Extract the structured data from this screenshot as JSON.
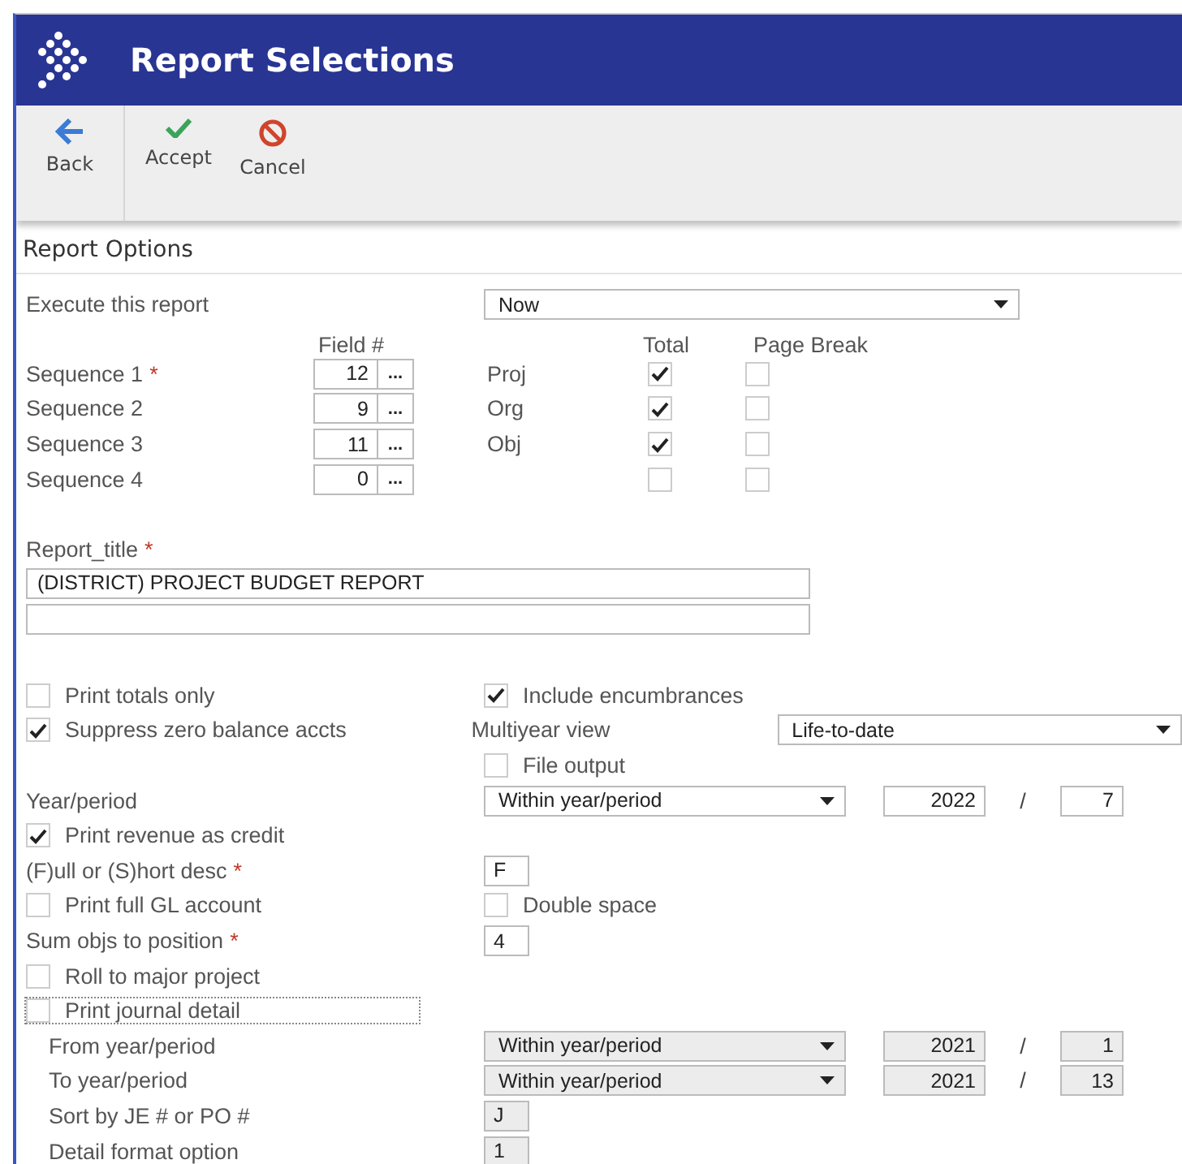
{
  "header": {
    "title": "Report Selections"
  },
  "toolbar": [
    {
      "kind": "back",
      "label": "Back"
    },
    {
      "kind": "accept",
      "label": "Accept"
    },
    {
      "kind": "cancel",
      "label": "Cancel"
    }
  ],
  "section_title": "Report Options",
  "execute": {
    "label": "Execute this report",
    "value": "Now"
  },
  "sequence": {
    "field_heading": "Field #",
    "total_heading": "Total",
    "page_break_heading": "Page Break",
    "more": "...",
    "rows": [
      {
        "label": "Sequence 1",
        "required_mark": "*",
        "field": "12",
        "name": "Proj",
        "total": true,
        "page_break": false
      },
      {
        "label": "Sequence 2",
        "field": "9",
        "name": "Org",
        "total": true,
        "page_break": false
      },
      {
        "label": "Sequence 3",
        "field": "11",
        "name": "Obj",
        "total": true,
        "page_break": false
      },
      {
        "label": "Sequence 4",
        "field": "0",
        "total": false,
        "page_break": false
      }
    ]
  },
  "report_title": {
    "label": "Report_title",
    "required_mark": "*",
    "lines": [
      "(DISTRICT) PROJECT BUDGET REPORT"
    ]
  },
  "options": [
    {
      "left": {
        "kind": "checkbox",
        "label": "Print totals only",
        "checked": false
      },
      "right": [
        {
          "kind": "checkbox",
          "label": "Include encumbrances",
          "checked": true
        }
      ]
    },
    {
      "left": {
        "kind": "checkbox",
        "label": "Suppress zero balance accts",
        "checked": true
      },
      "right": [
        {
          "kind": "caption",
          "label": "Multiyear view"
        },
        {
          "kind": "wide-select",
          "value": "Life-to-date",
          "disabled": false
        }
      ]
    },
    {
      "right": [
        {
          "kind": "checkbox",
          "label": "File output",
          "checked": false
        }
      ]
    },
    {
      "left": {
        "kind": "label",
        "label": "Year/period"
      },
      "right": [
        {
          "kind": "select",
          "value": "Within year/period",
          "disabled": false
        },
        {
          "kind": "year",
          "value": "2022",
          "disabled": false
        },
        {
          "kind": "slash",
          "text": "/"
        },
        {
          "kind": "period",
          "value": "7",
          "disabled": false
        }
      ]
    },
    {
      "left": {
        "kind": "checkbox",
        "label": "Print revenue as credit",
        "checked": true
      }
    },
    {
      "left": {
        "kind": "label",
        "label": "(F)ull or (S)hort desc",
        "required_mark": "*"
      },
      "right": [
        {
          "kind": "char",
          "value": "F",
          "disabled": false
        }
      ]
    },
    {
      "left": {
        "kind": "checkbox",
        "label": "Print full GL account",
        "checked": false
      },
      "right": [
        {
          "kind": "checkbox",
          "label": "Double space",
          "checked": false
        }
      ]
    },
    {
      "left": {
        "kind": "label",
        "label": "Sum objs to position",
        "required_mark": "*"
      },
      "right": [
        {
          "kind": "char",
          "value": "4",
          "disabled": false
        }
      ]
    },
    {
      "left": {
        "kind": "checkbox",
        "label": "Roll to major project",
        "checked": false
      }
    },
    {
      "left": {
        "kind": "checkbox",
        "label": "Print journal detail",
        "checked": false,
        "focused": true
      }
    },
    {
      "left": {
        "kind": "sublabel",
        "label": "From year/period"
      },
      "right": [
        {
          "kind": "select",
          "value": "Within year/period",
          "disabled": true
        },
        {
          "kind": "year",
          "value": "2021",
          "disabled": true
        },
        {
          "kind": "slash",
          "text": "/"
        },
        {
          "kind": "period",
          "value": "1",
          "disabled": true
        }
      ]
    },
    {
      "left": {
        "kind": "sublabel",
        "label": "To year/period"
      },
      "right": [
        {
          "kind": "select",
          "value": "Within year/period",
          "disabled": true
        },
        {
          "kind": "year",
          "value": "2021",
          "disabled": true
        },
        {
          "kind": "slash",
          "text": "/"
        },
        {
          "kind": "period",
          "value": "13",
          "disabled": true
        }
      ]
    },
    {
      "left": {
        "kind": "sublabel",
        "label": "Sort by JE # or PO #"
      },
      "right": [
        {
          "kind": "char",
          "value": "J",
          "disabled": true
        }
      ]
    },
    {
      "left": {
        "kind": "sublabel",
        "label": "Detail format option"
      },
      "right": [
        {
          "kind": "char",
          "value": "1",
          "disabled": true
        }
      ]
    }
  ]
}
